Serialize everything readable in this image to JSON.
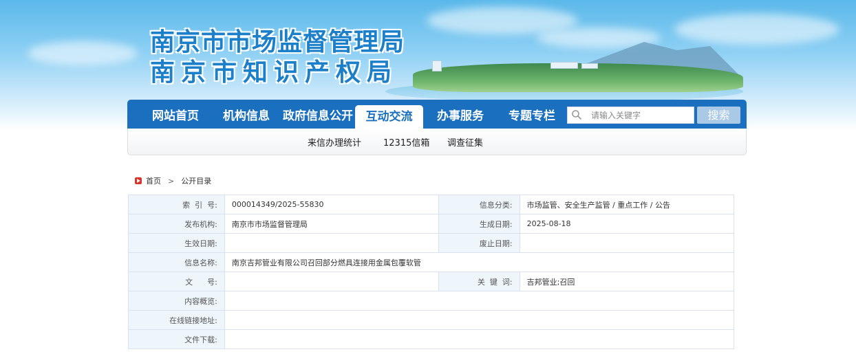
{
  "header": {
    "title_line1": "南京市市场监督管理局",
    "title_line2": "南京市知识产权局"
  },
  "nav": {
    "items": [
      {
        "label": "网站首页"
      },
      {
        "label": "机构信息"
      },
      {
        "label": "政府信息公开"
      },
      {
        "label": "互动交流",
        "active": true
      },
      {
        "label": "办事服务"
      },
      {
        "label": "专题专栏"
      }
    ],
    "search_placeholder": "请输入关键字",
    "search_button": "搜索"
  },
  "subnav": {
    "items": [
      {
        "label": "来信办理统计"
      },
      {
        "label": "12315信箱"
      },
      {
        "label": "调查征集"
      }
    ]
  },
  "breadcrumb": {
    "home": "首页",
    "separator": ">",
    "current": "公开目录"
  },
  "info_table": {
    "index_label": "索  引  号:",
    "index_value": "000014349/2025-55830",
    "category_label": "信息分类:",
    "category_value": "市场监管、安全生产监管 / 重点工作 / 公告",
    "publisher_label": "发布机构:",
    "publisher_value": "南京市市场监督管理局",
    "created_label": "生成日期:",
    "created_value": "2025-08-18",
    "effective_label": "生效日期:",
    "effective_value": "",
    "expiry_label": "废止日期:",
    "expiry_value": "",
    "name_label": "信息名称:",
    "name_value": "南京吉邦管业有限公司召回部分燃具连接用金属包覆软管",
    "docno_label": "文      号:",
    "docno_value": "",
    "keyword_label": "关  键  词:",
    "keyword_value": "吉邦管业;召回",
    "summary_label": "内容概览:",
    "summary_value": "",
    "link_label": "在线链接地址:",
    "link_value": "",
    "download_label": "文件下载:",
    "download_value": ""
  }
}
